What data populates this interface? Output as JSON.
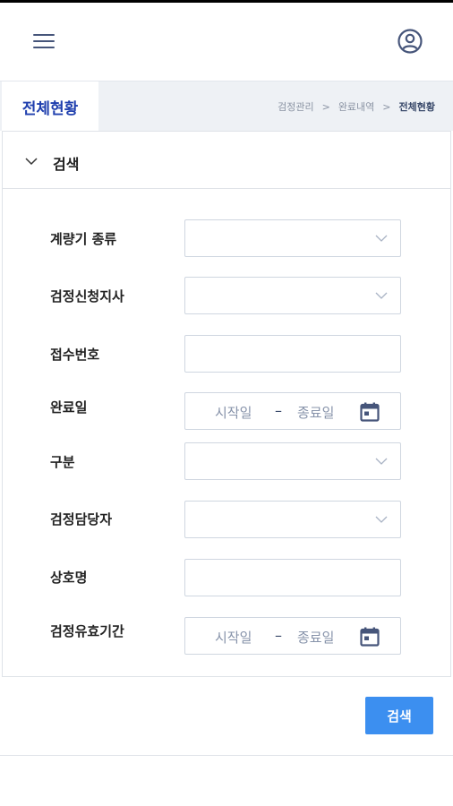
{
  "header": {
    "menu_icon": "hamburger-menu-icon",
    "profile_icon": "user-circle-icon"
  },
  "titlebar": {
    "page_title": "전체현황",
    "breadcrumb": [
      "검정관리",
      "완료내역",
      "전체현황"
    ],
    "separator": ">"
  },
  "search_panel": {
    "title": "검색",
    "fields": {
      "meter_type": {
        "label": "계량기 종류",
        "value": ""
      },
      "branch": {
        "label": "검정신청지사",
        "value": ""
      },
      "receipt_no": {
        "label": "접수번호",
        "value": ""
      },
      "completion_date": {
        "label": "완료일",
        "start_placeholder": "시작일",
        "dash": "–",
        "end_placeholder": "종료일"
      },
      "category": {
        "label": "구분",
        "value": ""
      },
      "inspector": {
        "label": "검정담당자",
        "value": ""
      },
      "company_name": {
        "label": "상호명",
        "value": ""
      },
      "validity_period": {
        "label": "검정유효기간",
        "start_placeholder": "시작일",
        "dash": "–",
        "end_placeholder": "종료일"
      }
    },
    "submit_label": "검색"
  },
  "colors": {
    "accent": "#3c8ff0",
    "title_blue": "#1f3fae",
    "icon_navy": "#46557a"
  }
}
